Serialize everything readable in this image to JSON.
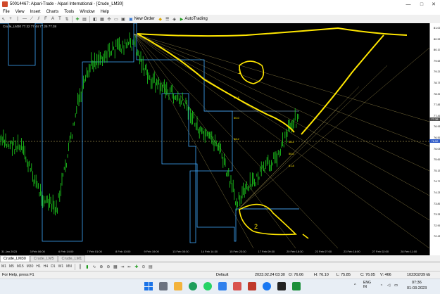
{
  "window": {
    "title": "50014467: Alpari-Trade - Alpari International - [Crude_LM30]",
    "minimize": "—",
    "maximize": "□",
    "close": "✕"
  },
  "menu": [
    "File",
    "View",
    "Insert",
    "Charts",
    "Tools",
    "Window",
    "Help"
  ],
  "toolbar": {
    "new_order_label": "New Order",
    "autotrading_label": "AutoTrading"
  },
  "chart": {
    "header": "Crude_LM30  77.32 77.44 77.25 77.38",
    "price_ticks": [
      "81.00",
      "80.55",
      "80.10",
      "79.65",
      "79.20",
      "78.75",
      "78.30",
      "77.85",
      "77.40",
      "76.95",
      "76.50",
      "76.05",
      "75.60",
      "75.15",
      "74.70",
      "74.25",
      "73.80",
      "73.35",
      "72.90",
      "72.45"
    ],
    "current_price": "77.38",
    "cursor_price": "76.52",
    "time_ticks": [
      "31 Jan 2023",
      "3 Feb 06:00",
      "6 Feb 14:00",
      "7 Feb 01:00",
      "8 Feb 10:00",
      "9 Feb 19:00",
      "13 Feb 05:30",
      "14 Feb 14:30",
      "15 Feb 23:30",
      "17 Feb 09:30",
      "20 Feb 18:30",
      "22 Feb 07:00",
      "23 Feb 16:00",
      "27 Feb 02:00",
      "28 Feb 11:00"
    ],
    "fib_labels": [
      "61.8",
      "50.0",
      "38.2",
      "38.2",
      "50.0",
      "61.8"
    ],
    "annotation_1": "1",
    "annotation_2": "2"
  },
  "tabs": [
    "Crude_LM30",
    "Crude_LM5",
    "Crude_LM1"
  ],
  "periods": [
    "M1",
    "M5",
    "M15",
    "M30",
    "H1",
    "H4",
    "D1",
    "W1",
    "MN"
  ],
  "status": {
    "help": "For Help, press F1",
    "profile": "Default",
    "time": "2023.02.24 03:30",
    "open": "O: 76.06",
    "high": "H: 76.10",
    "low": "L: 75.85",
    "close": "C: 76.05",
    "volume": "V: 466",
    "traffic": "102302/39 kb"
  },
  "taskbar": {
    "weather": "",
    "lang": "ENG\nIN",
    "clock_time": "07:36",
    "clock_date": "01-03-2023"
  },
  "colors": {
    "candles": "#1fd61f",
    "stepline": "#3fa9ff",
    "drawings": "#ffe600",
    "fib": "#d8c36a"
  }
}
